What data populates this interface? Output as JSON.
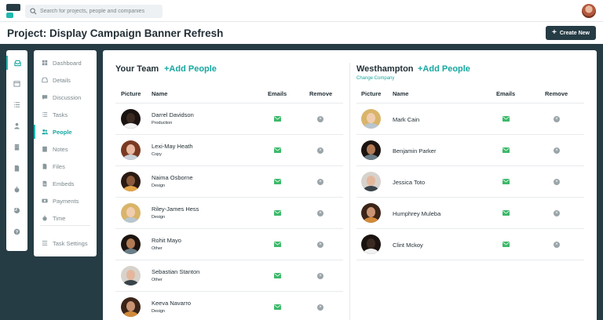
{
  "search": {
    "placeholder": "Search for projects, people and companies"
  },
  "header": {
    "title": "Project: Display Campaign Banner Refresh",
    "create_label": "Create New"
  },
  "subnav": {
    "items": [
      {
        "label": "Dashboard",
        "icon": "grid-icon"
      },
      {
        "label": "Details",
        "icon": "inbox-icon"
      },
      {
        "label": "Discussion",
        "icon": "chat-icon"
      },
      {
        "label": "Tasks",
        "icon": "list-icon"
      },
      {
        "label": "People",
        "icon": "people-icon",
        "active": true
      },
      {
        "label": "Notes",
        "icon": "notes-icon"
      },
      {
        "label": "Files",
        "icon": "files-icon"
      },
      {
        "label": "Embeds",
        "icon": "embed-icon"
      },
      {
        "label": "Payments",
        "icon": "payment-icon"
      },
      {
        "label": "Time",
        "icon": "clock-icon"
      }
    ],
    "settings_label": "Task Settings"
  },
  "left_panel": {
    "title": "Your Team",
    "add_label": "+Add People",
    "columns": [
      "Picture",
      "Name",
      "Emails",
      "Remove"
    ],
    "rows": [
      {
        "name": "Darrel Davidson",
        "role": "Production"
      },
      {
        "name": "Lexi-May Heath",
        "role": "Copy"
      },
      {
        "name": "Naima Osborne",
        "role": "Design"
      },
      {
        "name": "Riley-James Hess",
        "role": "Design"
      },
      {
        "name": "Rohit Mayo",
        "role": "Other"
      },
      {
        "name": "Sebastian Stanton",
        "role": "Other"
      },
      {
        "name": "Keeva Navarro",
        "role": "Design"
      }
    ]
  },
  "right_panel": {
    "title": "Westhampton",
    "add_label": "+Add People",
    "change_label": "Change Company",
    "columns": [
      "Picture",
      "Name",
      "Emails",
      "Remove"
    ],
    "rows": [
      {
        "name": "Mark Cain"
      },
      {
        "name": "Benjamin Parker"
      },
      {
        "name": "Jessica Toto"
      },
      {
        "name": "Humphrey Muleba"
      },
      {
        "name": "Clint Mckoy"
      }
    ]
  },
  "colors": {
    "dark": "#263c45",
    "accent": "#21b8b0",
    "email_green": "#3cb96a",
    "remove_grey": "#9aa5a9"
  }
}
